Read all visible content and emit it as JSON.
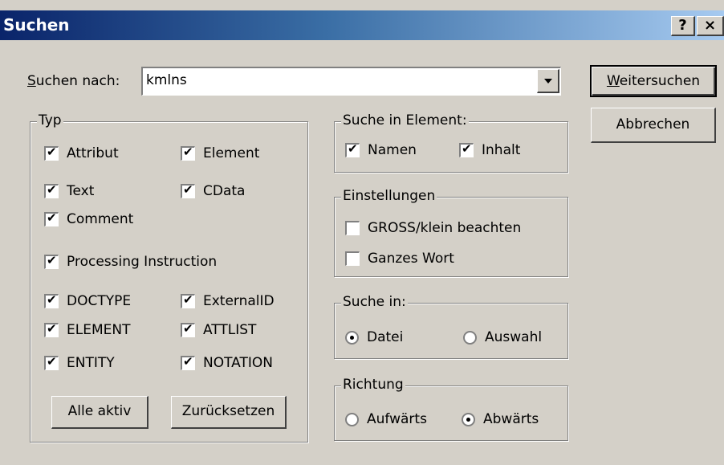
{
  "window": {
    "title": "Suchen",
    "help_button": "?",
    "close_button": "×"
  },
  "search": {
    "label_accel": "S",
    "label_rest": "uchen nach:",
    "value": "kmlns"
  },
  "buttons": {
    "find_next_accel": "W",
    "find_next_rest": "eitersuchen",
    "cancel": "Abbrechen",
    "all_active": "Alle aktiv",
    "reset": "Zurücksetzen"
  },
  "typ": {
    "title": "Typ",
    "items": [
      {
        "label": "Attribut",
        "checked": true
      },
      {
        "label": "Element",
        "checked": true
      },
      {
        "label": "Text",
        "checked": true
      },
      {
        "label": "CData",
        "checked": true
      },
      {
        "label": "Comment",
        "checked": true
      },
      {
        "label": "Processing Instruction",
        "checked": true
      },
      {
        "label": "DOCTYPE",
        "checked": true
      },
      {
        "label": "ExternalID",
        "checked": true
      },
      {
        "label": "ELEMENT",
        "checked": true
      },
      {
        "label": "ATTLIST",
        "checked": true
      },
      {
        "label": "ENTITY",
        "checked": true
      },
      {
        "label": "NOTATION",
        "checked": true
      }
    ]
  },
  "search_in_element": {
    "title": "Suche in Element:",
    "items": [
      {
        "label": "Namen",
        "checked": true
      },
      {
        "label": "Inhalt",
        "checked": true
      }
    ]
  },
  "settings": {
    "title": "Einstellungen",
    "items": [
      {
        "label": "GROSS/klein beachten",
        "checked": false
      },
      {
        "label": "Ganzes Wort",
        "checked": false
      }
    ]
  },
  "search_in": {
    "title": "Suche in:",
    "options": [
      {
        "label": "Datei",
        "selected": true
      },
      {
        "label": "Auswahl",
        "selected": false
      }
    ]
  },
  "direction": {
    "title": "Richtung",
    "options": [
      {
        "label": "Aufwärts",
        "selected": false
      },
      {
        "label": "Abwärts",
        "selected": true
      }
    ]
  }
}
